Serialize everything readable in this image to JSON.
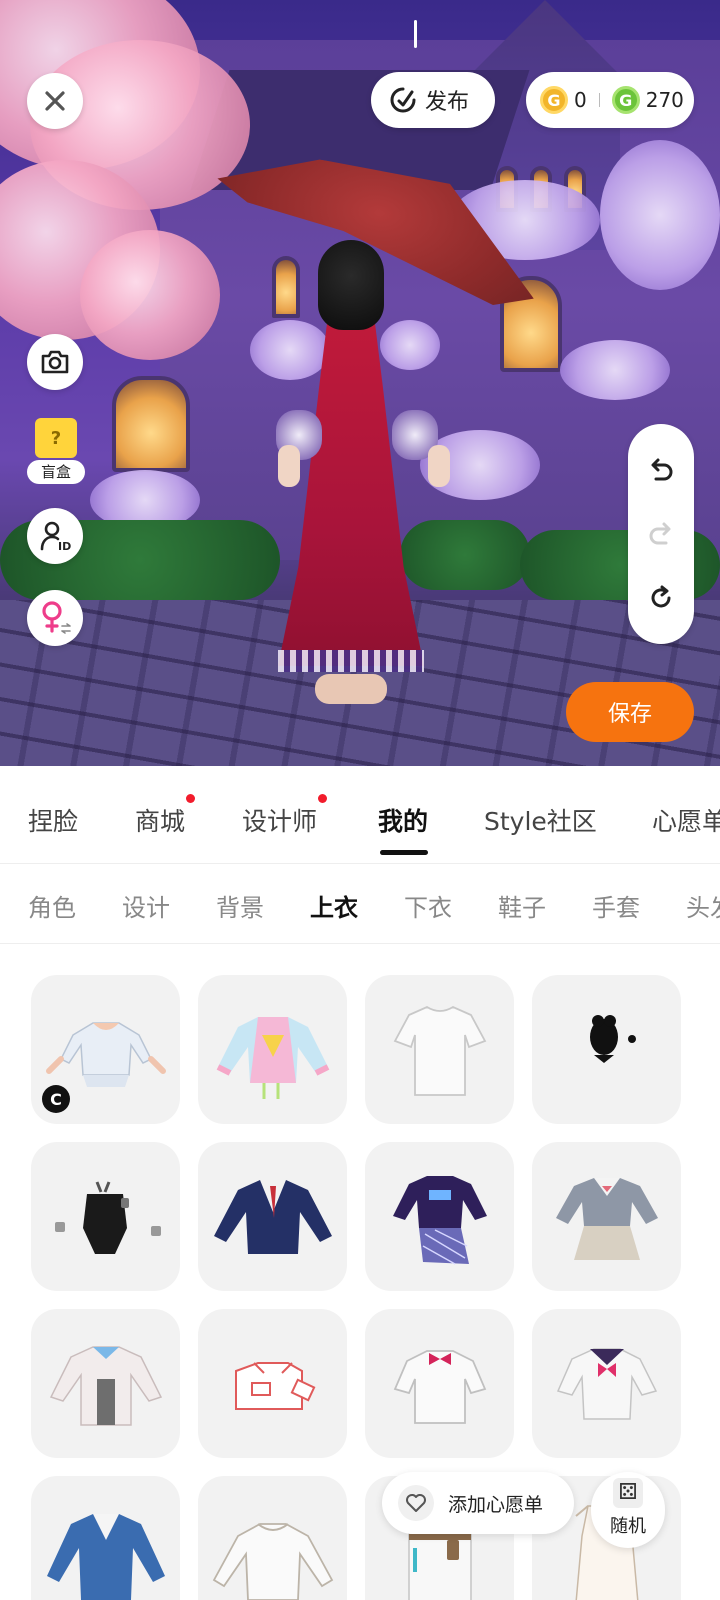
{
  "top_bar": {
    "close_icon": "close-icon",
    "publish_label": "发布",
    "publish_icon": "publish-icon",
    "gold_coin_count": "0",
    "green_coin_count": "270",
    "gold_coin_icon": "gold-coin-icon",
    "green_coin_icon": "green-coin-icon"
  },
  "left_tools": {
    "camera_icon": "camera-icon",
    "blind_box_label": "盲盒",
    "blind_box_icon_mark": "?",
    "id_icon": "avatar-id-icon",
    "gender_icon": "female-switch-icon"
  },
  "history": {
    "undo_icon": "undo-icon",
    "redo_icon": "redo-icon",
    "reset_icon": "refresh-icon"
  },
  "save_label": "保存",
  "main_tabs": [
    {
      "label": "捏脸",
      "active": false,
      "dot": false
    },
    {
      "label": "商城",
      "active": false,
      "dot": true
    },
    {
      "label": "设计师",
      "active": false,
      "dot": true
    },
    {
      "label": "我的",
      "active": true,
      "dot": false
    },
    {
      "label": "Style社区",
      "active": false,
      "dot": false
    },
    {
      "label": "心愿单",
      "active": false,
      "dot": false
    }
  ],
  "sub_tabs": [
    {
      "label": "角色",
      "active": false
    },
    {
      "label": "设计",
      "active": false
    },
    {
      "label": "背景",
      "active": false
    },
    {
      "label": "上衣",
      "active": true
    },
    {
      "label": "下衣",
      "active": false
    },
    {
      "label": "鞋子",
      "active": false
    },
    {
      "label": "手套",
      "active": false
    },
    {
      "label": "头发",
      "active": false
    }
  ],
  "items": [
    {
      "name": "white-crop-top",
      "badge": "C"
    },
    {
      "name": "pastel-hoodie"
    },
    {
      "name": "white-tshirt"
    },
    {
      "name": "black-accessory"
    },
    {
      "name": "black-swimsuit"
    },
    {
      "name": "navy-blazer"
    },
    {
      "name": "purple-sweater-skirt"
    },
    {
      "name": "grey-school-uniform"
    },
    {
      "name": "white-cardigan"
    },
    {
      "name": "red-outline-shirt"
    },
    {
      "name": "white-shirt-bow"
    },
    {
      "name": "sailor-top"
    },
    {
      "name": "blue-blazer"
    },
    {
      "name": "white-blouse"
    },
    {
      "name": "white-coat-belt"
    },
    {
      "name": "white-dress"
    }
  ],
  "wish_label": "添加心愿单",
  "wish_icon": "heart-icon",
  "random_label": "随机",
  "random_icon": "dice-icon"
}
